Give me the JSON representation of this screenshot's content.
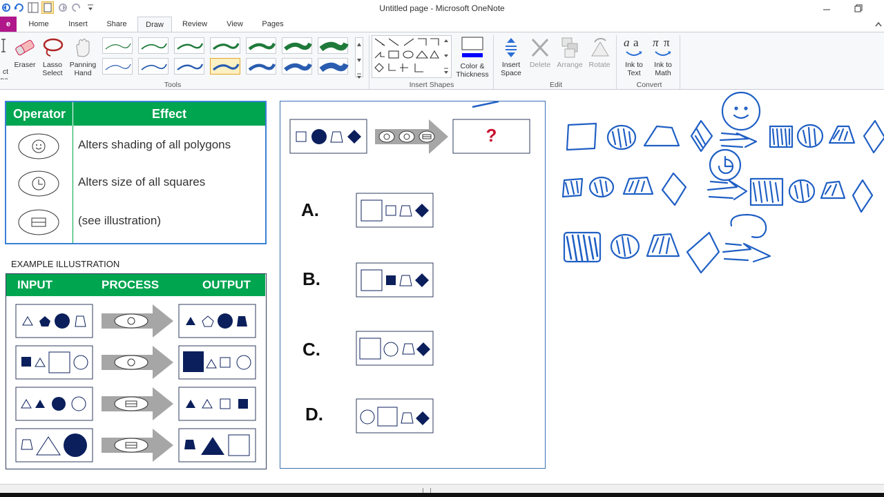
{
  "window": {
    "title": "Untitled page - Microsoft OneNote"
  },
  "ribbon": {
    "tabs": [
      "e",
      "Home",
      "Insert",
      "Share",
      "Draw",
      "Review",
      "View",
      "Pages"
    ],
    "active_tab": "Draw",
    "tools": {
      "select_label_1": "ct",
      "select_label_2": "pe",
      "eraser": "Eraser",
      "lasso_1": "Lasso",
      "lasso_2": "Select",
      "panning_1": "Panning",
      "panning_2": "Hand",
      "group": "Tools"
    },
    "insert_shapes": {
      "group": "Insert Shapes"
    },
    "color": {
      "label_1": "Color &",
      "label_2": "Thickness",
      "swatch": "#0000ff"
    },
    "edit": {
      "insert_space_1": "Insert",
      "insert_space_2": "Space",
      "delete": "Delete",
      "arrange": "Arrange",
      "rotate": "Rotate",
      "group": "Edit"
    },
    "convert": {
      "ink_text_1": "Ink to",
      "ink_text_2": "Text",
      "ink_math_1": "Ink to",
      "ink_math_2": "Math",
      "group": "Convert"
    }
  },
  "operator_table": {
    "header_operator": "Operator",
    "header_effect": "Effect",
    "rows": [
      {
        "icon": "smiley-icon",
        "effect": "Alters shading of all polygons"
      },
      {
        "icon": "clock-icon",
        "effect": "Alters size of all squares"
      },
      {
        "icon": "stack-icon",
        "effect": "(see illustration)"
      }
    ]
  },
  "illustration": {
    "caption": "EXAMPLE ILLUSTRATION",
    "input": "INPUT",
    "process": "PROCESS",
    "output": "OUTPUT"
  },
  "question": {
    "unknown": "?",
    "options": [
      "A.",
      "B.",
      "C.",
      "D."
    ]
  },
  "colors": {
    "green": "#00a550",
    "navy": "#0b1f5c",
    "ink": "#1f5fc4",
    "accent": "#c8102e"
  }
}
